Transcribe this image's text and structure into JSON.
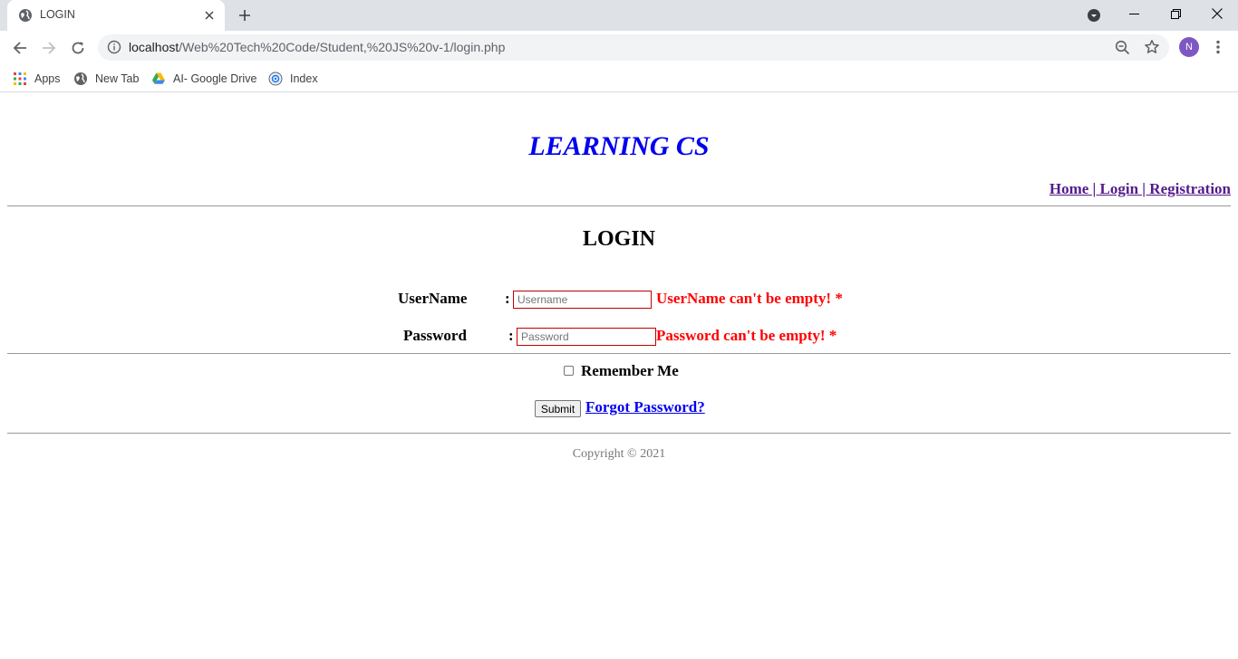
{
  "browser": {
    "tab": {
      "title": "LOGIN"
    },
    "address_bar": {
      "host": "localhost",
      "path": "/Web%20Tech%20Code/Student,%20JS%20v-1/login.php"
    },
    "profile_initial": "N",
    "bookmarks": [
      {
        "label": "Apps",
        "icon": "apps-grid-icon"
      },
      {
        "label": "New Tab",
        "icon": "globe-icon"
      },
      {
        "label": "AI- Google Drive",
        "icon": "google-drive-icon"
      },
      {
        "label": "Index",
        "icon": "index-favicon-icon"
      }
    ]
  },
  "page": {
    "site_title": "LEARNING CS",
    "nav_links": "Home | Login | Registration",
    "heading": "LOGIN",
    "form": {
      "username_label": "UserName",
      "username_placeholder": "Username",
      "username_error": "UserName can't be empty! *",
      "password_label": "Password",
      "password_placeholder": "Password",
      "password_error": "Password can't be empty! *",
      "colon": ":",
      "remember_label": "Remember Me",
      "remember_checked": false,
      "submit_label": "Submit",
      "forgot_label": "Forgot Password?"
    },
    "footer": "Copyright © 2021"
  },
  "colors": {
    "title_blue": "#0000ee",
    "visited_purple": "#551a8b",
    "error_red": "#ff0000",
    "field_border": "#c00000"
  }
}
